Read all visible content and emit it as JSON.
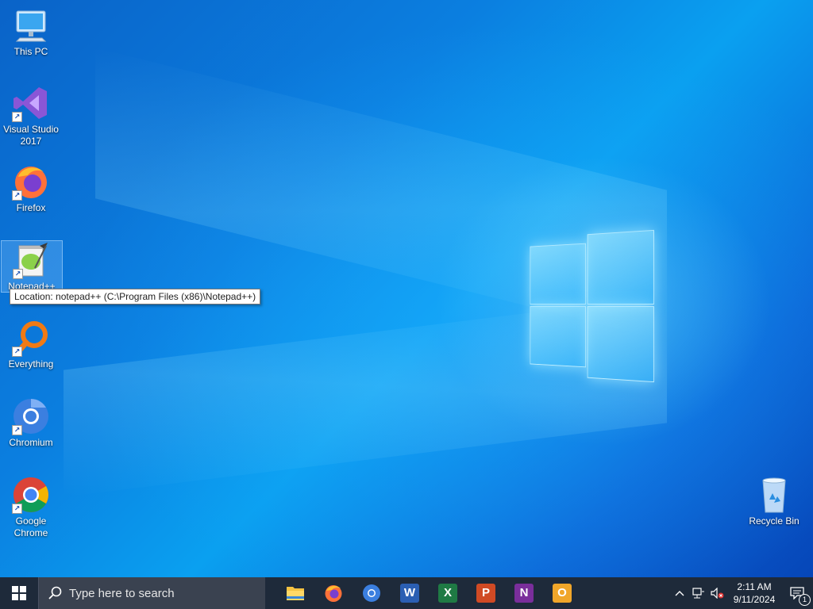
{
  "desktop": {
    "icons": [
      {
        "label": "This PC",
        "icon": "monitor-icon"
      },
      {
        "label": "Visual Studio 2017",
        "icon": "visual-studio-icon"
      },
      {
        "label": "Firefox",
        "icon": "firefox-icon"
      },
      {
        "label": "Notepad++",
        "icon": "notepadpp-icon"
      },
      {
        "label": "Everything",
        "icon": "search-magnifier-icon"
      },
      {
        "label": "Chromium",
        "icon": "chromium-icon"
      },
      {
        "label": "Google Chrome",
        "icon": "chrome-icon"
      },
      {
        "label": "Recycle Bin",
        "icon": "recycle-bin-icon"
      }
    ],
    "tooltip": "Location: notepad++ (C:\\Program Files (x86)\\Notepad++)"
  },
  "taskbar": {
    "search_placeholder": "Type here to search",
    "pinned": [
      {
        "name": "File Explorer",
        "icon": "folder-icon",
        "color": "#f5c342"
      },
      {
        "name": "Firefox",
        "icon": "firefox-icon",
        "color": "#ff6a1a"
      },
      {
        "name": "Chromium",
        "icon": "chromium-icon",
        "color": "#4a8ef0"
      },
      {
        "name": "Word",
        "icon": "word-icon",
        "color": "#2b5fb3",
        "letter": "W"
      },
      {
        "name": "Excel",
        "icon": "excel-icon",
        "color": "#1f7a44",
        "letter": "X"
      },
      {
        "name": "PowerPoint",
        "icon": "powerpoint-icon",
        "color": "#d04a24",
        "letter": "P"
      },
      {
        "name": "OneNote",
        "icon": "onenote-icon",
        "color": "#7a2e9b",
        "letter": "N"
      },
      {
        "name": "Outlook",
        "icon": "outlook-icon",
        "color": "#f0a62a",
        "letter": "O"
      }
    ],
    "clock": {
      "time": "2:11 AM",
      "date": "9/11/2024"
    },
    "notification_count": "1"
  }
}
